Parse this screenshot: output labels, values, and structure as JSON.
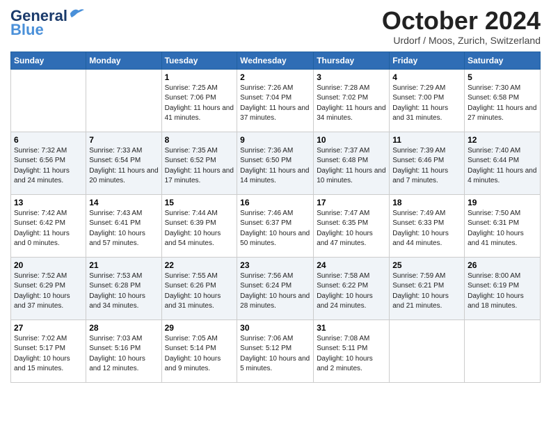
{
  "header": {
    "logo_line1": "General",
    "logo_line2": "Blue",
    "month_title": "October 2024",
    "location": "Urdorf / Moos, Zurich, Switzerland"
  },
  "days_of_week": [
    "Sunday",
    "Monday",
    "Tuesday",
    "Wednesday",
    "Thursday",
    "Friday",
    "Saturday"
  ],
  "weeks": [
    [
      {
        "day": "",
        "sunrise": "",
        "sunset": "",
        "daylight": ""
      },
      {
        "day": "",
        "sunrise": "",
        "sunset": "",
        "daylight": ""
      },
      {
        "day": "1",
        "sunrise": "Sunrise: 7:25 AM",
        "sunset": "Sunset: 7:06 PM",
        "daylight": "Daylight: 11 hours and 41 minutes."
      },
      {
        "day": "2",
        "sunrise": "Sunrise: 7:26 AM",
        "sunset": "Sunset: 7:04 PM",
        "daylight": "Daylight: 11 hours and 37 minutes."
      },
      {
        "day": "3",
        "sunrise": "Sunrise: 7:28 AM",
        "sunset": "Sunset: 7:02 PM",
        "daylight": "Daylight: 11 hours and 34 minutes."
      },
      {
        "day": "4",
        "sunrise": "Sunrise: 7:29 AM",
        "sunset": "Sunset: 7:00 PM",
        "daylight": "Daylight: 11 hours and 31 minutes."
      },
      {
        "day": "5",
        "sunrise": "Sunrise: 7:30 AM",
        "sunset": "Sunset: 6:58 PM",
        "daylight": "Daylight: 11 hours and 27 minutes."
      }
    ],
    [
      {
        "day": "6",
        "sunrise": "Sunrise: 7:32 AM",
        "sunset": "Sunset: 6:56 PM",
        "daylight": "Daylight: 11 hours and 24 minutes."
      },
      {
        "day": "7",
        "sunrise": "Sunrise: 7:33 AM",
        "sunset": "Sunset: 6:54 PM",
        "daylight": "Daylight: 11 hours and 20 minutes."
      },
      {
        "day": "8",
        "sunrise": "Sunrise: 7:35 AM",
        "sunset": "Sunset: 6:52 PM",
        "daylight": "Daylight: 11 hours and 17 minutes."
      },
      {
        "day": "9",
        "sunrise": "Sunrise: 7:36 AM",
        "sunset": "Sunset: 6:50 PM",
        "daylight": "Daylight: 11 hours and 14 minutes."
      },
      {
        "day": "10",
        "sunrise": "Sunrise: 7:37 AM",
        "sunset": "Sunset: 6:48 PM",
        "daylight": "Daylight: 11 hours and 10 minutes."
      },
      {
        "day": "11",
        "sunrise": "Sunrise: 7:39 AM",
        "sunset": "Sunset: 6:46 PM",
        "daylight": "Daylight: 11 hours and 7 minutes."
      },
      {
        "day": "12",
        "sunrise": "Sunrise: 7:40 AM",
        "sunset": "Sunset: 6:44 PM",
        "daylight": "Daylight: 11 hours and 4 minutes."
      }
    ],
    [
      {
        "day": "13",
        "sunrise": "Sunrise: 7:42 AM",
        "sunset": "Sunset: 6:42 PM",
        "daylight": "Daylight: 11 hours and 0 minutes."
      },
      {
        "day": "14",
        "sunrise": "Sunrise: 7:43 AM",
        "sunset": "Sunset: 6:41 PM",
        "daylight": "Daylight: 10 hours and 57 minutes."
      },
      {
        "day": "15",
        "sunrise": "Sunrise: 7:44 AM",
        "sunset": "Sunset: 6:39 PM",
        "daylight": "Daylight: 10 hours and 54 minutes."
      },
      {
        "day": "16",
        "sunrise": "Sunrise: 7:46 AM",
        "sunset": "Sunset: 6:37 PM",
        "daylight": "Daylight: 10 hours and 50 minutes."
      },
      {
        "day": "17",
        "sunrise": "Sunrise: 7:47 AM",
        "sunset": "Sunset: 6:35 PM",
        "daylight": "Daylight: 10 hours and 47 minutes."
      },
      {
        "day": "18",
        "sunrise": "Sunrise: 7:49 AM",
        "sunset": "Sunset: 6:33 PM",
        "daylight": "Daylight: 10 hours and 44 minutes."
      },
      {
        "day": "19",
        "sunrise": "Sunrise: 7:50 AM",
        "sunset": "Sunset: 6:31 PM",
        "daylight": "Daylight: 10 hours and 41 minutes."
      }
    ],
    [
      {
        "day": "20",
        "sunrise": "Sunrise: 7:52 AM",
        "sunset": "Sunset: 6:29 PM",
        "daylight": "Daylight: 10 hours and 37 minutes."
      },
      {
        "day": "21",
        "sunrise": "Sunrise: 7:53 AM",
        "sunset": "Sunset: 6:28 PM",
        "daylight": "Daylight: 10 hours and 34 minutes."
      },
      {
        "day": "22",
        "sunrise": "Sunrise: 7:55 AM",
        "sunset": "Sunset: 6:26 PM",
        "daylight": "Daylight: 10 hours and 31 minutes."
      },
      {
        "day": "23",
        "sunrise": "Sunrise: 7:56 AM",
        "sunset": "Sunset: 6:24 PM",
        "daylight": "Daylight: 10 hours and 28 minutes."
      },
      {
        "day": "24",
        "sunrise": "Sunrise: 7:58 AM",
        "sunset": "Sunset: 6:22 PM",
        "daylight": "Daylight: 10 hours and 24 minutes."
      },
      {
        "day": "25",
        "sunrise": "Sunrise: 7:59 AM",
        "sunset": "Sunset: 6:21 PM",
        "daylight": "Daylight: 10 hours and 21 minutes."
      },
      {
        "day": "26",
        "sunrise": "Sunrise: 8:00 AM",
        "sunset": "Sunset: 6:19 PM",
        "daylight": "Daylight: 10 hours and 18 minutes."
      }
    ],
    [
      {
        "day": "27",
        "sunrise": "Sunrise: 7:02 AM",
        "sunset": "Sunset: 5:17 PM",
        "daylight": "Daylight: 10 hours and 15 minutes."
      },
      {
        "day": "28",
        "sunrise": "Sunrise: 7:03 AM",
        "sunset": "Sunset: 5:16 PM",
        "daylight": "Daylight: 10 hours and 12 minutes."
      },
      {
        "day": "29",
        "sunrise": "Sunrise: 7:05 AM",
        "sunset": "Sunset: 5:14 PM",
        "daylight": "Daylight: 10 hours and 9 minutes."
      },
      {
        "day": "30",
        "sunrise": "Sunrise: 7:06 AM",
        "sunset": "Sunset: 5:12 PM",
        "daylight": "Daylight: 10 hours and 5 minutes."
      },
      {
        "day": "31",
        "sunrise": "Sunrise: 7:08 AM",
        "sunset": "Sunset: 5:11 PM",
        "daylight": "Daylight: 10 hours and 2 minutes."
      },
      {
        "day": "",
        "sunrise": "",
        "sunset": "",
        "daylight": ""
      },
      {
        "day": "",
        "sunrise": "",
        "sunset": "",
        "daylight": ""
      }
    ]
  ]
}
